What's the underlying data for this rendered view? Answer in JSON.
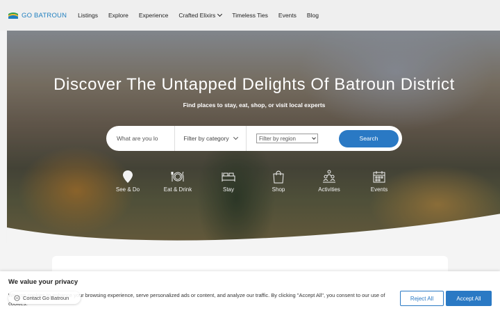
{
  "brand": {
    "name": "GO BATROUN"
  },
  "nav": {
    "items": [
      {
        "label": "Listings"
      },
      {
        "label": "Explore"
      },
      {
        "label": "Experience"
      },
      {
        "label": "Crafted Elixirs",
        "has_dropdown": true
      },
      {
        "label": "Timeless Ties"
      },
      {
        "label": "Events"
      },
      {
        "label": "Blog"
      }
    ]
  },
  "hero": {
    "title": "Discover The Untapped Delights Of Batroun District",
    "subtitle": "Find places to stay, eat, shop, or visit local experts"
  },
  "search": {
    "placeholder": "What are you lo",
    "category_label": "Filter by category",
    "region_label": "Filter by region",
    "button_label": "Search"
  },
  "categories": [
    {
      "label": "See & Do",
      "icon": "map-pin-icon"
    },
    {
      "label": "Eat & Drink",
      "icon": "plate-cutlery-icon"
    },
    {
      "label": "Stay",
      "icon": "bed-icon"
    },
    {
      "label": "Shop",
      "icon": "shopping-bag-icon"
    },
    {
      "label": "Activities",
      "icon": "people-group-icon"
    },
    {
      "label": "Events",
      "icon": "calendar-icon"
    }
  ],
  "cookie": {
    "title": "We value your privacy",
    "text": "We use cookies to enhance your browsing experience, serve personalized ads or content, and analyze our traffic. By clicking \"Accept All\", you consent to our use of cookies.",
    "reject_label": "Reject All",
    "accept_label": "Accept All"
  },
  "contact": {
    "label": "Contact Go Batroun"
  },
  "colors": {
    "accent": "#2a79c4",
    "header_bg": "#efefef"
  }
}
